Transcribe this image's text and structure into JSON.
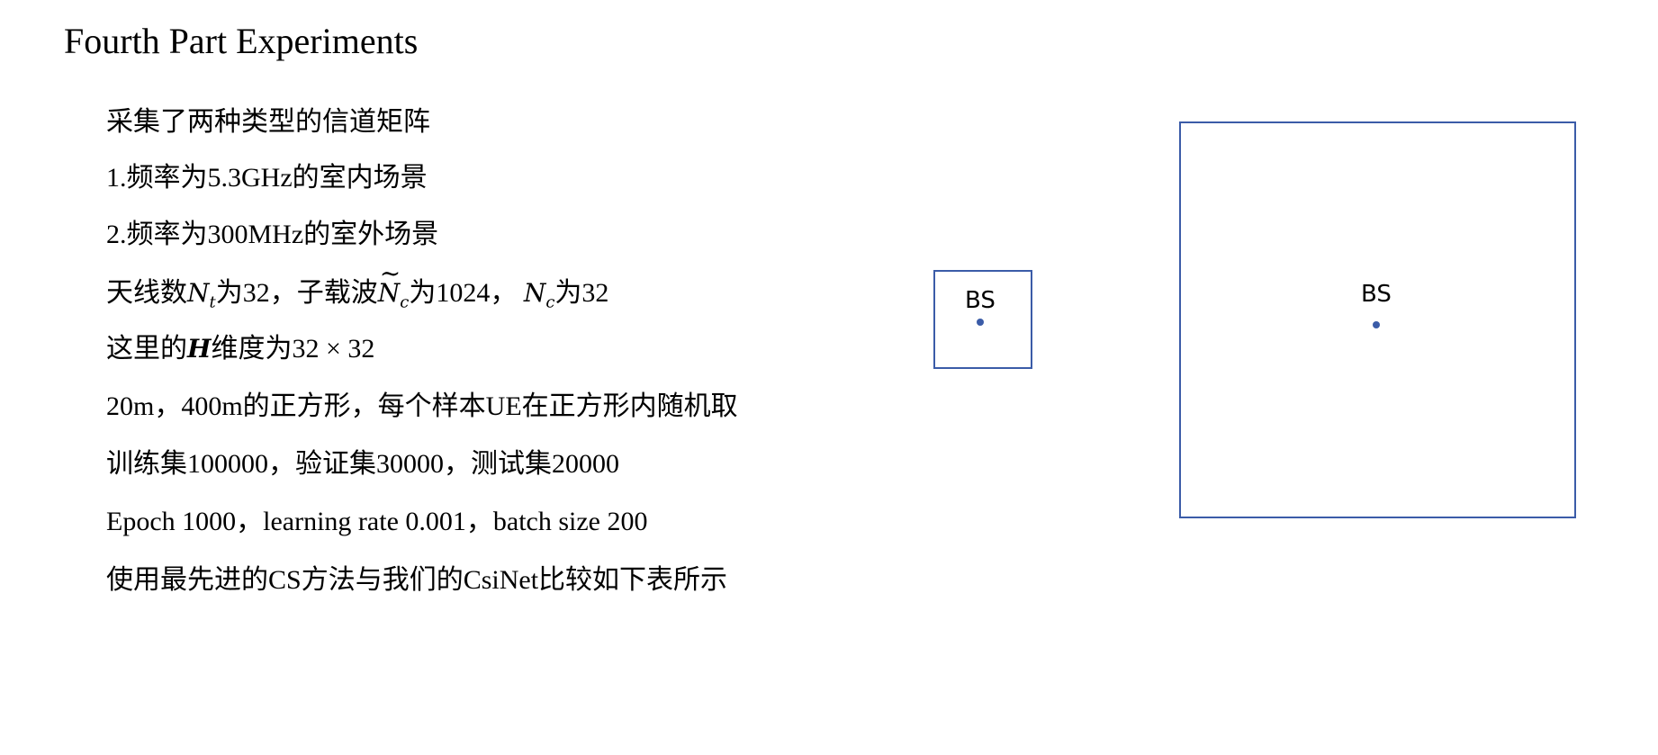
{
  "title": "Fourth Part Experiments",
  "lines": {
    "l1": "采集了两种类型的信道矩阵",
    "l2": "1.频率为5.3GHz的室内场景",
    "l3": "2.频率为300MHz的室外场景",
    "l4a": "天线数",
    "l4_nt": "N",
    "l4_nt_sub": "t",
    "l4b": "为32，子载波",
    "l4_nc": "N",
    "l4_nc_sub": "c",
    "l4c": "为1024，",
    "l4_nc2": "N",
    "l4_nc2_sub": "c",
    "l4d": "为32",
    "l5a": "这里的",
    "l5_h": "H",
    "l5b": "维度为32 × 32",
    "l6": "20m，400m的正方形，每个样本UE在正方形内随机取",
    "l7": "训练集100000，验证集30000，测试集20000",
    "l8": "Epoch 1000，learning rate 0.001，batch size 200",
    "l9": "使用最先进的CS方法与我们的CsiNet比较如下表所示"
  },
  "diagram": {
    "small_label": "BS",
    "large_label": "BS",
    "color": "#3b5ca8"
  }
}
